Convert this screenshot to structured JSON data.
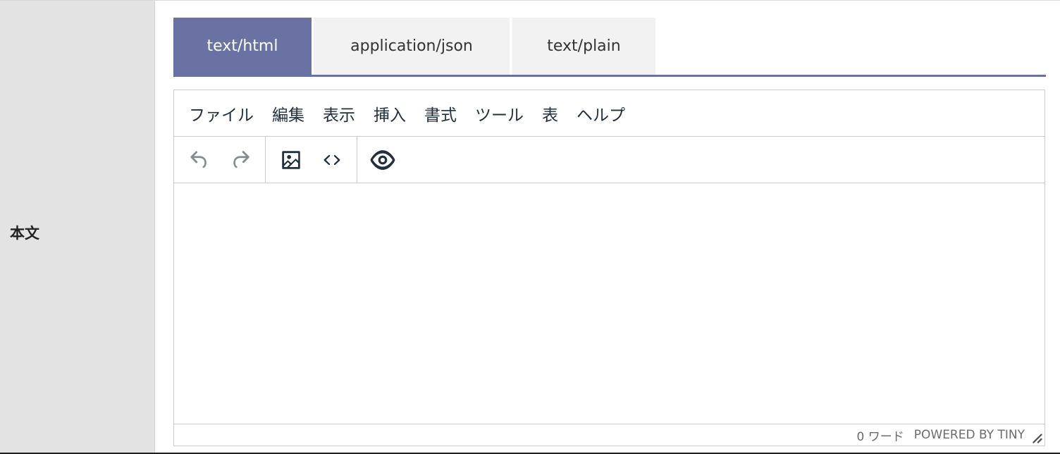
{
  "field_label": "本文",
  "tabs": [
    {
      "label": "text/html",
      "active": true
    },
    {
      "label": "application/json",
      "active": false
    },
    {
      "label": "text/plain",
      "active": false
    }
  ],
  "editor": {
    "menu": [
      "ファイル",
      "編集",
      "表示",
      "挿入",
      "書式",
      "ツール",
      "表",
      "ヘルプ"
    ],
    "toolbar": {
      "icons": [
        "undo-icon",
        "redo-icon",
        "image-icon",
        "code-icon",
        "preview-icon"
      ]
    },
    "status": {
      "wordcount": "0 ワード",
      "powered_by": "POWERED BY TINY"
    }
  },
  "colors": {
    "accent": "#6a72a3",
    "label_bg": "#e3e3e3",
    "tab_bg": "#f2f2f2",
    "border": "#cccccc"
  }
}
